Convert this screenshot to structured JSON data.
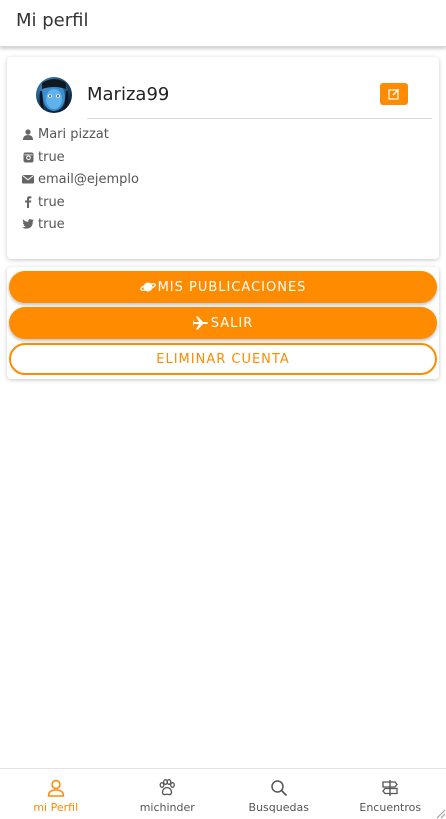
{
  "header": {
    "title": "Mi perfil"
  },
  "profile": {
    "username": "Mariza99",
    "full_name": "Mari pizzat",
    "instagram": "true",
    "email": "email@ejemplo",
    "facebook": "true",
    "twitter": "true",
    "avatar_icon": "avatar-image",
    "edit_icon": "edit-icon"
  },
  "actions": {
    "publications_label": "MIS PUBLICACIONES",
    "logout_label": "SALIR",
    "delete_label": "ELIMINAR CUENTA"
  },
  "bottom_nav": {
    "items": [
      {
        "label": "mi Perfil",
        "icon": "user-icon",
        "active": true
      },
      {
        "label": "michinder",
        "icon": "paw-icon",
        "active": false
      },
      {
        "label": "Busquedas",
        "icon": "search-icon",
        "active": false
      },
      {
        "label": "Encuentros",
        "icon": "signpost-icon",
        "active": false
      }
    ]
  },
  "colors": {
    "accent": "#ff8c00",
    "text": "#222222",
    "muted": "#555555"
  }
}
